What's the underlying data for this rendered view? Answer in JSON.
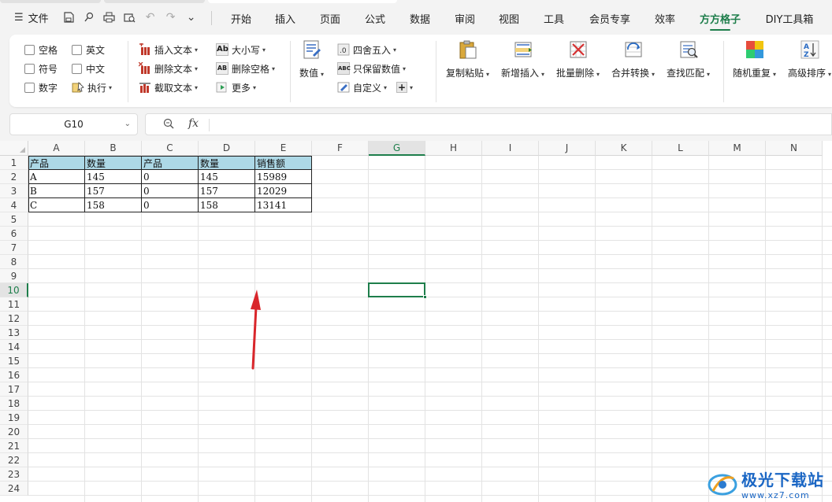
{
  "menubar": {
    "file_label": "文件",
    "tabs": [
      {
        "label": "开始",
        "active": false
      },
      {
        "label": "插入",
        "active": false
      },
      {
        "label": "页面",
        "active": false
      },
      {
        "label": "公式",
        "active": false
      },
      {
        "label": "数据",
        "active": false
      },
      {
        "label": "审阅",
        "active": false
      },
      {
        "label": "视图",
        "active": false
      },
      {
        "label": "工具",
        "active": false
      },
      {
        "label": "会员专享",
        "active": false
      },
      {
        "label": "效率",
        "active": false
      },
      {
        "label": "方方格子",
        "active": true
      },
      {
        "label": "DIY工具箱",
        "active": false
      }
    ]
  },
  "ribbon": {
    "checkboxes": {
      "space": "空格",
      "english": "英文",
      "symbol": "符号",
      "chinese": "中文",
      "digit": "数字",
      "execute": "执行"
    },
    "text_ops": {
      "insert_text": "插入文本",
      "delete_text": "删除文本",
      "extract_text": "截取文本",
      "case": "大小写",
      "delete_space": "删除空格",
      "more": "更多"
    },
    "numeric": {
      "value": "数值",
      "round": "四舍五入",
      "keep_numeric": "只保留数值",
      "custom": "自定义"
    },
    "big_buttons": {
      "copy_paste": "复制粘贴",
      "new_insert": "新增插入",
      "batch_delete": "批量删除",
      "merge_convert": "合并转换",
      "find_match": "查找匹配",
      "random_repeat": "随机重复",
      "advanced_sort": "高级排序"
    }
  },
  "formula_bar": {
    "name_box": "G10",
    "fx_label": "fx",
    "value": ""
  },
  "sheet": {
    "columns": [
      "A",
      "B",
      "C",
      "D",
      "E",
      "F",
      "G",
      "H",
      "I",
      "J",
      "K",
      "L",
      "M",
      "N"
    ],
    "selected_column": "G",
    "rows": [
      "1",
      "2",
      "3",
      "4",
      "5",
      "6",
      "7",
      "8",
      "9",
      "10",
      "11",
      "12",
      "13",
      "14",
      "15",
      "16",
      "17",
      "18",
      "19",
      "20",
      "21",
      "22",
      "23",
      "24"
    ],
    "selected_row": "10",
    "table": [
      [
        "产品",
        "数量",
        "产品",
        "数量",
        "销售额"
      ],
      [
        "A",
        "145",
        "0",
        "145",
        "15989"
      ],
      [
        "B",
        "157",
        "0",
        "157",
        "12029"
      ],
      [
        "C",
        "158",
        "0",
        "158",
        "13141"
      ]
    ]
  },
  "watermark": {
    "title": "极光下载站",
    "url": "www.xz7.com"
  },
  "colors": {
    "accent": "#1e7e4b",
    "header_fill": "#add8e6",
    "arrow": "#d9262b"
  }
}
